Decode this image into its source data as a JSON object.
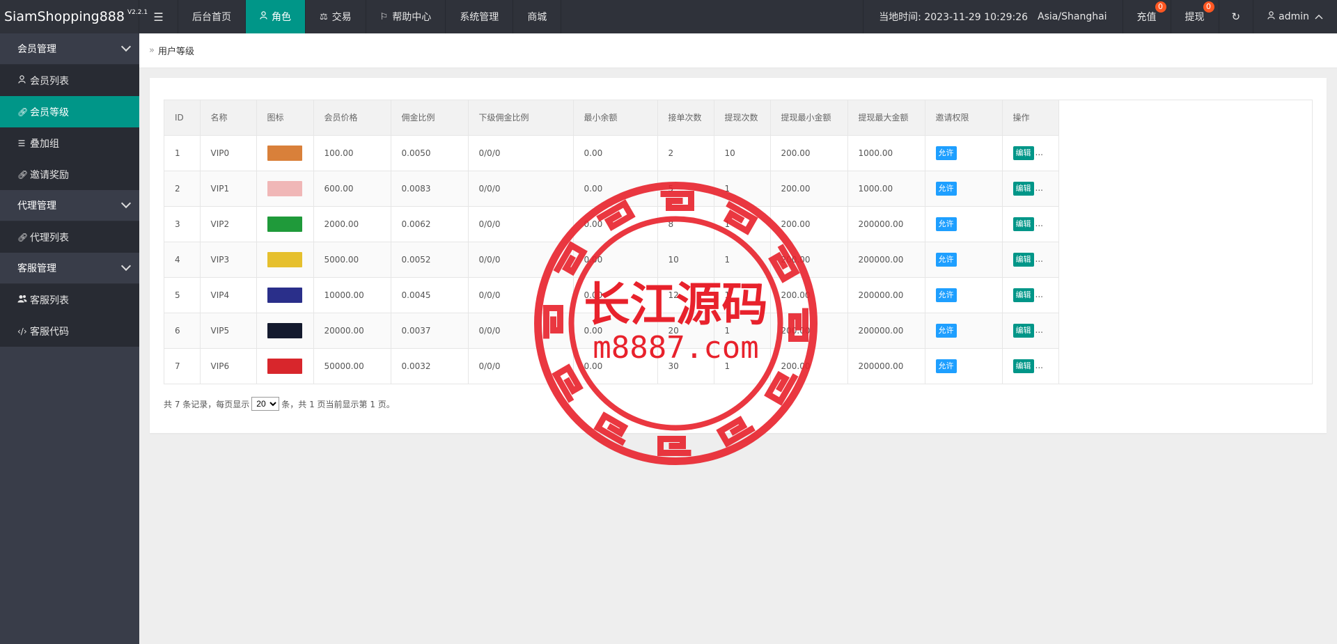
{
  "app": {
    "title": "SiamShopping888",
    "version": "V2.2.1"
  },
  "nav": {
    "items": [
      {
        "label": "后台首页",
        "icon": "",
        "active": false
      },
      {
        "label": "角色",
        "icon": "user-icon",
        "active": true
      },
      {
        "label": "交易",
        "icon": "scale-icon",
        "active": false
      },
      {
        "label": "帮助中心",
        "icon": "flag-icon",
        "active": false
      },
      {
        "label": "系统管理",
        "icon": "",
        "active": false
      },
      {
        "label": "商城",
        "icon": "",
        "active": false
      }
    ]
  },
  "header": {
    "clock_label": "当地时间: 2023-11-29 10:29:26",
    "timezone": "Asia/Shanghai",
    "recharge": {
      "label": "充值",
      "count": "0"
    },
    "withdraw": {
      "label": "提现",
      "count": "0"
    },
    "user": "admin"
  },
  "sidebar": {
    "groups": [
      {
        "label": "会员管理",
        "items": [
          {
            "label": "会员列表",
            "icon": "user-icon",
            "active": false
          },
          {
            "label": "会员等级",
            "icon": "link-icon",
            "active": true
          },
          {
            "label": "叠加组",
            "icon": "list-icon",
            "active": false
          },
          {
            "label": "邀请奖励",
            "icon": "link-icon",
            "active": false
          }
        ]
      },
      {
        "label": "代理管理",
        "items": [
          {
            "label": "代理列表",
            "icon": "link-icon",
            "active": false
          }
        ]
      },
      {
        "label": "客服管理",
        "items": [
          {
            "label": "客服列表",
            "icon": "users-icon",
            "active": false
          },
          {
            "label": "客服代码",
            "icon": "code-icon",
            "active": false
          }
        ]
      }
    ]
  },
  "breadcrumb": {
    "current": "用户等级"
  },
  "table": {
    "columns": [
      "ID",
      "名称",
      "图标",
      "会员价格",
      "佣金比例",
      "下级佣金比例",
      "最小余额",
      "接单次数",
      "提现次数",
      "提现最小金额",
      "提现最大金额",
      "邀请权限",
      "操作"
    ],
    "allow_label": "允许",
    "edit_label": "编辑",
    "more_label": "...",
    "rows": [
      {
        "id": "1",
        "name": "VIP0",
        "icon_color": "#d9803a",
        "price": "100.00",
        "rate": "0.0050",
        "sub_rate": "0/0/0",
        "min_balance": "0.00",
        "orders": "2",
        "withdraw_times": "10",
        "wd_min": "200.00",
        "wd_max": "1000.00"
      },
      {
        "id": "2",
        "name": "VIP1",
        "icon_color": "#f0b7b7",
        "price": "600.00",
        "rate": "0.0083",
        "sub_rate": "0/0/0",
        "min_balance": "0.00",
        "orders": "5",
        "withdraw_times": "1",
        "wd_min": "200.00",
        "wd_max": "1000.00"
      },
      {
        "id": "3",
        "name": "VIP2",
        "icon_color": "#1f9a3a",
        "price": "2000.00",
        "rate": "0.0062",
        "sub_rate": "0/0/0",
        "min_balance": "0.00",
        "orders": "8",
        "withdraw_times": "1",
        "wd_min": "200.00",
        "wd_max": "200000.00"
      },
      {
        "id": "4",
        "name": "VIP3",
        "icon_color": "#e6c02e",
        "price": "5000.00",
        "rate": "0.0052",
        "sub_rate": "0/0/0",
        "min_balance": "0.00",
        "orders": "10",
        "withdraw_times": "1",
        "wd_min": "200.00",
        "wd_max": "200000.00"
      },
      {
        "id": "5",
        "name": "VIP4",
        "icon_color": "#2a2f8a",
        "price": "10000.00",
        "rate": "0.0045",
        "sub_rate": "0/0/0",
        "min_balance": "0.00",
        "orders": "12",
        "withdraw_times": "1",
        "wd_min": "200.00",
        "wd_max": "200000.00"
      },
      {
        "id": "6",
        "name": "VIP5",
        "icon_color": "#141a2e",
        "price": "20000.00",
        "rate": "0.0037",
        "sub_rate": "0/0/0",
        "min_balance": "0.00",
        "orders": "20",
        "withdraw_times": "1",
        "wd_min": "200.00",
        "wd_max": "200000.00"
      },
      {
        "id": "7",
        "name": "VIP6",
        "icon_color": "#d8262c",
        "price": "50000.00",
        "rate": "0.0032",
        "sub_rate": "0/0/0",
        "min_balance": "0.00",
        "orders": "30",
        "withdraw_times": "1",
        "wd_min": "200.00",
        "wd_max": "200000.00"
      }
    ]
  },
  "pager": {
    "prefix": "共 7 条记录，每页显示",
    "page_size": "20",
    "suffix": "条，共 1 页当前显示第 1 页。"
  },
  "watermark": {
    "title": "长江源码",
    "url": "m8887.com",
    "color": "#e8222c"
  }
}
